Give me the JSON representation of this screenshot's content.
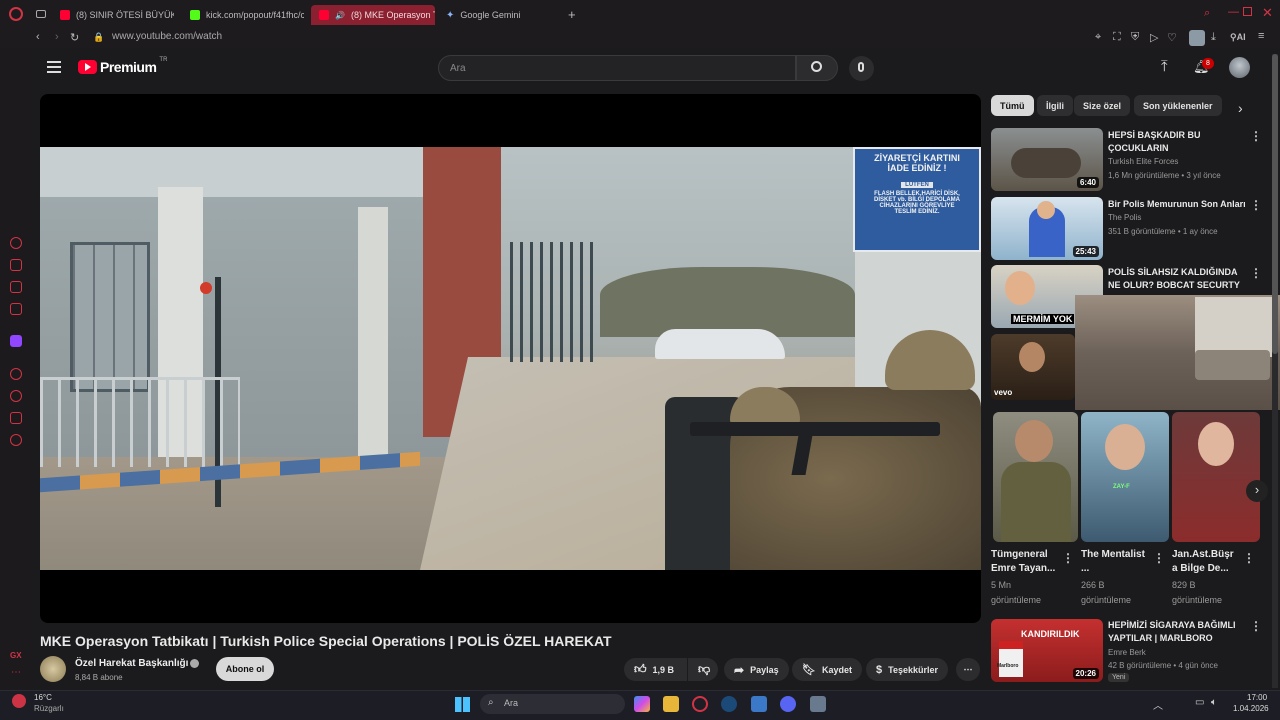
{
  "browser": {
    "tabs": [
      {
        "label": "(8) SINIR ÖTESİ BÜYÜK O"
      },
      {
        "label": "kick.com/popout/f41fhc/c"
      },
      {
        "label": "(8) MKE Operasyon Ta"
      },
      {
        "label": "Google Gemini"
      }
    ],
    "url": "www.youtube.com/watch",
    "ai_label": "AI"
  },
  "yt": {
    "logo": "Premium",
    "logo_suffix": "TR",
    "search_placeholder": "Ara",
    "notif_count": "8"
  },
  "video": {
    "title": "MKE Operasyon Tatbikatı | Turkish Police Special Operations | POLİS ÖZEL HAREKAT",
    "channel": "Özel Harekat Başkanlığı",
    "subscribers": "8,84 B abone",
    "subscribe_label": "Abone ol",
    "likes": "1,9 B",
    "share_label": "Paylaş",
    "save_label": "Kaydet",
    "thanks_label": "Teşekkürler",
    "sign_lines": [
      "ZİYARETÇİ KARTINI",
      "İADE EDİNİZ !",
      "LÜTFEN",
      "FLASH BELLEK,HARİCİ DİSK,",
      "DİSKET vb. BİLGİ DEPOLAMA",
      "CİHAZLARINI GÖREVLİYE",
      "TESLİM EDİNİZ."
    ]
  },
  "chips": [
    "Tümü",
    "İlgili",
    "Size özel",
    "Son yüklenenler"
  ],
  "related": [
    {
      "title": "HEPSİ BAŞKADIR BU ÇOCUKLARIN",
      "channel": "Turkish Elite Forces",
      "meta": "1,6 Mn görüntüleme • 3 yıl önce",
      "duration": "6:40"
    },
    {
      "title": "Bir Polis Memurunun Son Anları",
      "channel": "The Polis",
      "meta": "351 B görüntüleme • 1 ay önce",
      "duration": "25:43"
    },
    {
      "title": "POLİS SİLAHSIZ KALDIĞINDA NE OLUR? BOBCAT SECURTY ...",
      "thumb_text": "MERMİM YOK"
    },
    {
      "thumb_text": "vevo"
    }
  ],
  "shorts": [
    {
      "title": "Tümgeneral Emre Tayan...",
      "views": "5 Mn görüntüleme"
    },
    {
      "title": "The Mentalist ...",
      "views": "266 B görüntüleme",
      "badge": "ZAY-F"
    },
    {
      "title": "Jan.Ast.Büşr a Bilge De...",
      "views": "829 B görüntüleme"
    }
  ],
  "bottom_related": {
    "title": "HEPİMİZİ SİGARAYA BAĞIMLI YAPTILAR | MARLBORO",
    "channel": "Emre Berk",
    "meta": "42 B görüntüleme • 4 gün önce",
    "duration": "20:26",
    "badge": "Yeni",
    "thumb_text": "KANDIRILDIK",
    "brand": "Marlboro"
  },
  "taskbar": {
    "temp": "16°C",
    "weather": "Rüzgarlı",
    "search": "Ara",
    "time": "17:00",
    "date": "1.04.2026"
  },
  "sidebar_text": "GX",
  "colors": {
    "accent": "#d23446",
    "yt_red": "#ff0033"
  }
}
